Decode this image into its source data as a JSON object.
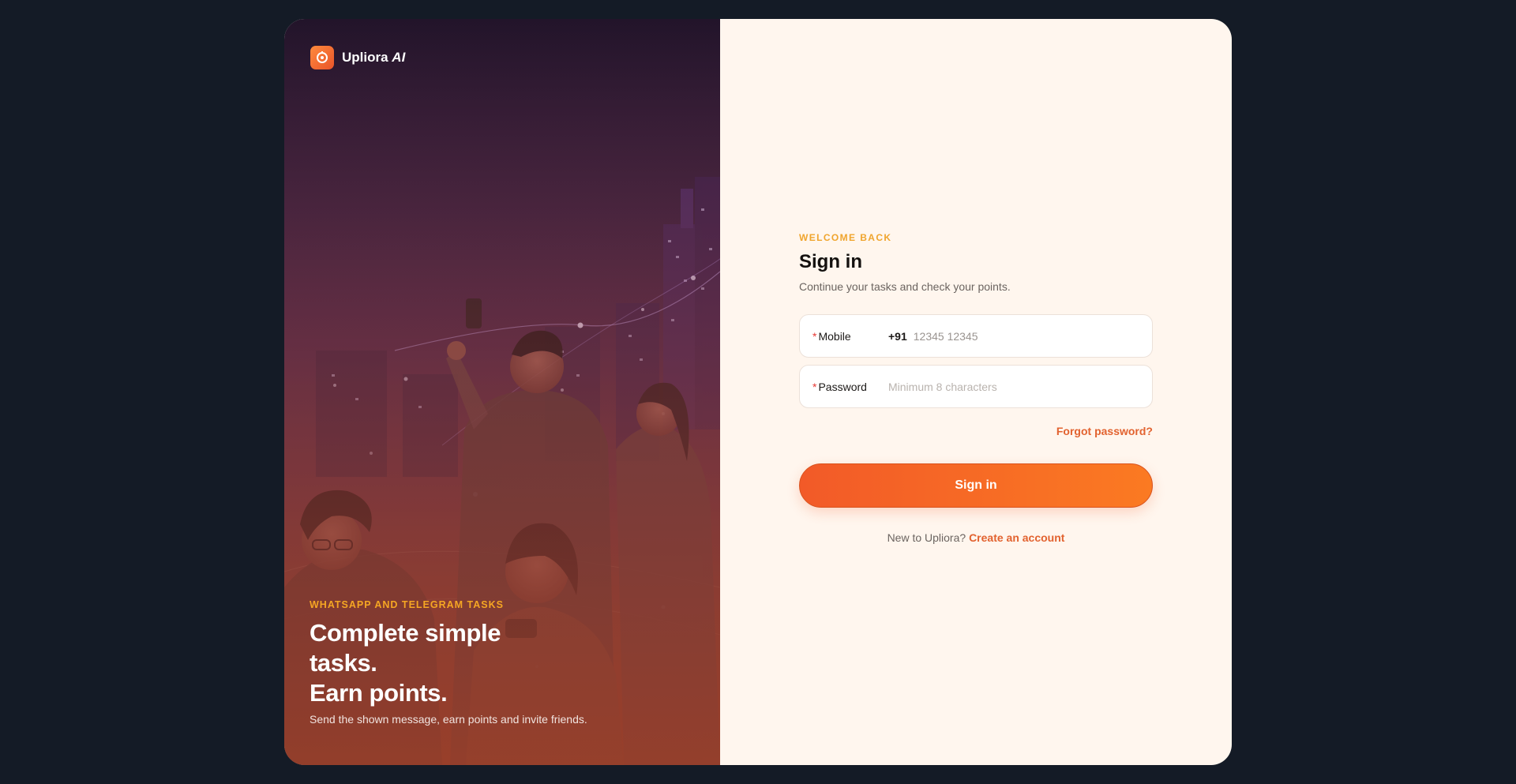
{
  "brand": {
    "name": "Upliora",
    "suffix": "AI"
  },
  "hero": {
    "kicker": "WHATSAPP AND TELEGRAM TASKS",
    "title_line1": "Complete simple",
    "title_line2": "tasks.",
    "title_line3": "Earn points.",
    "subtitle": "Send the shown message, earn points and invite friends."
  },
  "signin": {
    "welcome": "WELCOME BACK",
    "title": "Sign in",
    "subtitle": "Continue your tasks and check your points.",
    "mobile": {
      "required_mark": "*",
      "label": "Mobile",
      "prefix": "+91",
      "placeholder": "12345 12345",
      "value": ""
    },
    "password": {
      "required_mark": "*",
      "label": "Password",
      "placeholder": "Minimum 8 characters",
      "value": ""
    },
    "forgot_label": "Forgot password?",
    "button_label": "Sign in",
    "signup_prompt": "New to Upliora?",
    "signup_link": "Create an account"
  },
  "colors": {
    "accent": "#f26a2a",
    "kicker": "#f0a52e",
    "required": "#e53935",
    "page_bg": "#141b26",
    "form_bg": "#fff6ee"
  }
}
